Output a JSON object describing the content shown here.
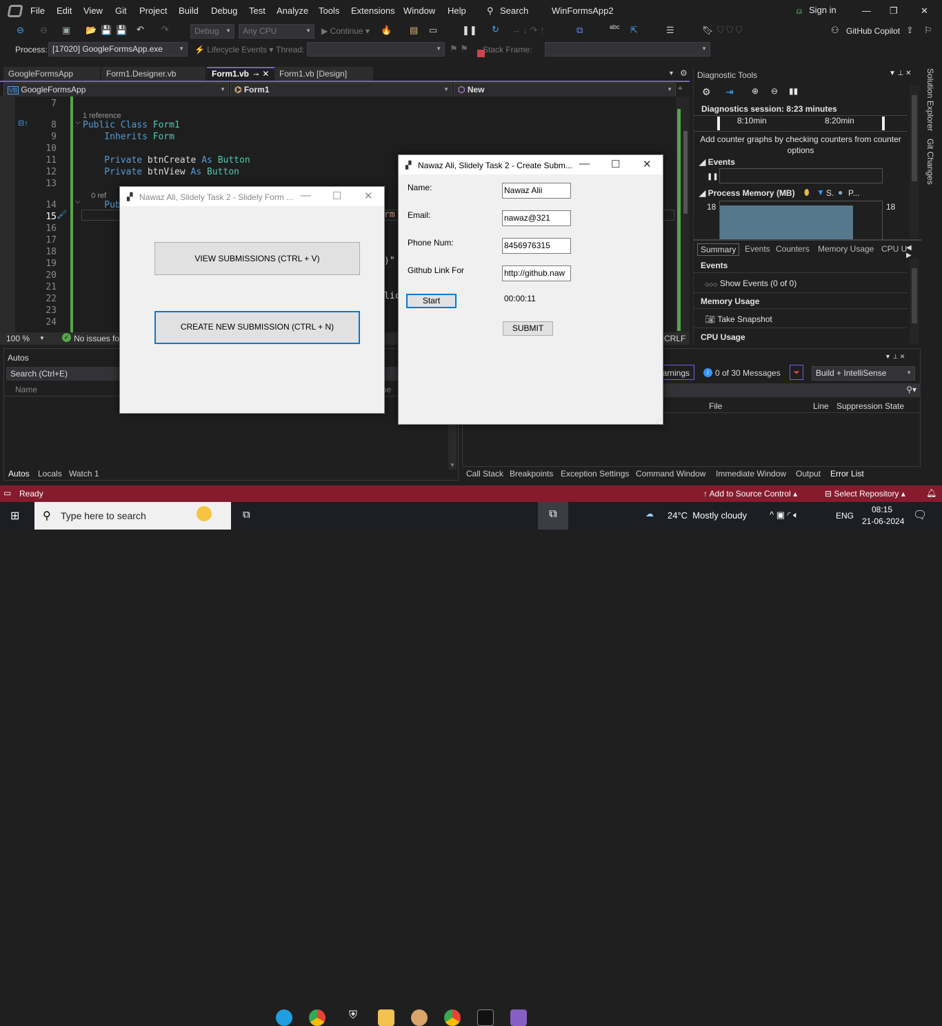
{
  "menu": {
    "items": [
      "File",
      "Edit",
      "View",
      "Git",
      "Project",
      "Build",
      "Debug",
      "Test",
      "Analyze",
      "Tools",
      "Extensions",
      "Window",
      "Help"
    ],
    "search": "Search",
    "title": "WinFormsApp2",
    "sign_in": "Sign in"
  },
  "toolbar": {
    "config": "Debug",
    "platform": "Any CPU",
    "continue": "Continue",
    "copilot": "GitHub Copilot",
    "process_label": "Process:",
    "process": "[17020] GoogleFormsApp.exe",
    "lifecycle": "Lifecycle Events",
    "thread_label": "Thread:",
    "stack_label": "Stack Frame:"
  },
  "tabs": [
    {
      "label": "GoogleFormsApp"
    },
    {
      "label": "Form1.Designer.vb"
    },
    {
      "label": "Form1.vb"
    },
    {
      "label": "Form1.vb [Design]"
    }
  ],
  "nav": {
    "project": "GoogleFormsApp",
    "class": "Form1",
    "member": "New"
  },
  "editor": {
    "lines": [
      {
        "n": "7",
        "tokens": []
      },
      {
        "n": "",
        "tokens": [
          {
            "t": "1 reference",
            "c": "cm"
          }
        ]
      },
      {
        "n": "8",
        "tokens": [
          {
            "t": "Public Class ",
            "c": "kw"
          },
          {
            "t": "Form1",
            "c": "ty"
          }
        ]
      },
      {
        "n": "9",
        "tokens": [
          {
            "t": "    Inherits ",
            "c": "kw"
          },
          {
            "t": "Form",
            "c": "ty"
          }
        ]
      },
      {
        "n": "10",
        "tokens": []
      },
      {
        "n": "11",
        "tokens": [
          {
            "t": "    Private ",
            "c": "kw"
          },
          {
            "t": "btnCreate ",
            "c": "id"
          },
          {
            "t": "As ",
            "c": "kw"
          },
          {
            "t": "Button",
            "c": "ty"
          }
        ]
      },
      {
        "n": "12",
        "tokens": [
          {
            "t": "    Private ",
            "c": "kw"
          },
          {
            "t": "btnView ",
            "c": "id"
          },
          {
            "t": "As ",
            "c": "kw"
          },
          {
            "t": "Button",
            "c": "ty"
          }
        ]
      },
      {
        "n": "13",
        "tokens": []
      },
      {
        "n": "",
        "tokens": [
          {
            "t": "    0 ref",
            "c": "cm"
          }
        ]
      },
      {
        "n": "14",
        "tokens": [
          {
            "t": "    Pub",
            "c": "kw"
          }
        ]
      },
      {
        "n": "15",
        "tokens": []
      },
      {
        "n": "16",
        "tokens": []
      },
      {
        "n": "17",
        "tokens": []
      },
      {
        "n": "18",
        "tokens": []
      },
      {
        "n": "19",
        "tokens": []
      },
      {
        "n": "20",
        "tokens": []
      },
      {
        "n": "21",
        "tokens": []
      },
      {
        "n": "22",
        "tokens": []
      },
      {
        "n": "23",
        "tokens": []
      },
      {
        "n": "24",
        "tokens": []
      }
    ],
    "frag_rm": "rm",
    "frag_quote": ")\"",
    "frag_lic": "lic",
    "zoom": "100 %",
    "issues": "No issues fou",
    "eol": "CRLF"
  },
  "autos": {
    "title": "Autos",
    "search": "Search (Ctrl+E)",
    "col_name": "Name",
    "col_type": "pe",
    "tabs": [
      "Autos",
      "Locals",
      "Watch 1"
    ]
  },
  "errors": {
    "warnings": "arnings",
    "messages": "0 of 30 Messages",
    "scope": "Build + IntelliSense",
    "cols": [
      "File",
      "Line",
      "Suppression State"
    ],
    "tabs": [
      "Call Stack",
      "Breakpoints",
      "Exception Settings",
      "Command Window",
      "Immediate Window",
      "Output",
      "Error List"
    ]
  },
  "diag": {
    "title": "Diagnostic Tools",
    "session": "Diagnostics session: 8:23 minutes",
    "t1": "8:10min",
    "t2": "8:20min",
    "hint": "Add counter graphs by checking counters from counter options",
    "events": "Events",
    "memory": "Process Memory (MB)",
    "legend_s": "S.",
    "legend_p": "P...",
    "mem_left": "18",
    "mem_right": "18",
    "tabs": [
      "Summary",
      "Events",
      "Counters",
      "Memory Usage",
      "CPU U"
    ],
    "sec_events": "Events",
    "show_events": "Show Events (0 of 0)",
    "sec_mem": "Memory Usage",
    "snapshot": "Take Snapshot",
    "sec_cpu": "CPU Usage",
    "memory_value_mb": 18
  },
  "side": {
    "solution": "Solution Explorer",
    "git": "Git Changes"
  },
  "form1": {
    "title": "Nawaz Ali, Slidely Task 2 - Slidely Form ...",
    "view": "VIEW SUBMISSIONS (CTRL + V)",
    "create": "CREATE NEW SUBMISSION (CTRL + N)"
  },
  "form2": {
    "title": "Nawaz Ali, Slidely Task 2 - Create Subm...",
    "name_l": "Name:",
    "name_v": "Nawaz Alii",
    "email_l": "Email:",
    "email_v": "nawaz@321",
    "phone_l": "Phone Num:",
    "phone_v": "8456976315",
    "gh_l": "Github Link For",
    "gh_v": "http://github.naw",
    "start": "Start",
    "timer": "00:00:11",
    "submit": "SUBMIT"
  },
  "status": {
    "ready": "Ready",
    "source": "Add to Source Control",
    "repo": "Select Repository"
  },
  "taskbar": {
    "search": "Type here to search",
    "weather": "24°C  Mostly cloudy",
    "lang": "ENG",
    "time": "08:15",
    "date": "21-06-2024"
  },
  "colors": {
    "accent": "#7160e8",
    "status": "#861b2d",
    "green": "#57a64a"
  }
}
